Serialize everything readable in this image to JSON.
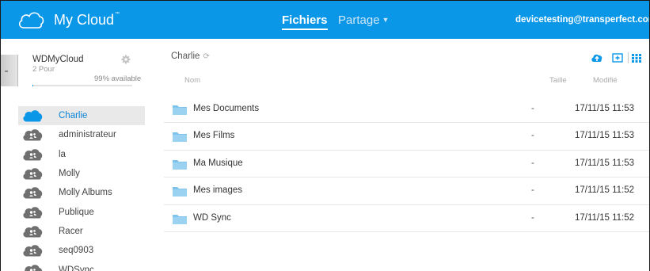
{
  "header": {
    "app_title": "My Cloud",
    "trademark": "™",
    "tabs": [
      {
        "label": "Fichiers",
        "active": true
      },
      {
        "label": "Partage",
        "active": false
      }
    ],
    "user_email": "devicetesting@transperfect.com",
    "brand_color": "#0a97e8"
  },
  "device": {
    "name": "WDMyCloud",
    "subtitle": "2 Pour",
    "storage_available": "99% available",
    "storage_used_percent": 1
  },
  "sidebar": {
    "shares": [
      {
        "label": "Charlie",
        "active": true,
        "icon": "cloud-icon"
      },
      {
        "label": "administrateur",
        "active": false,
        "icon": "shared-cloud-icon"
      },
      {
        "label": "la",
        "active": false,
        "icon": "shared-cloud-icon"
      },
      {
        "label": "Molly",
        "active": false,
        "icon": "shared-cloud-icon"
      },
      {
        "label": "Molly Albums",
        "active": false,
        "icon": "shared-cloud-icon"
      },
      {
        "label": "Publique",
        "active": false,
        "icon": "shared-cloud-icon"
      },
      {
        "label": "Racer",
        "active": false,
        "icon": "shared-cloud-icon"
      },
      {
        "label": "seq0903",
        "active": false,
        "icon": "shared-cloud-icon"
      },
      {
        "label": "WDSync",
        "active": false,
        "icon": "shared-cloud-icon"
      }
    ]
  },
  "main": {
    "breadcrumb": "Charlie",
    "columns": {
      "name": "Nom",
      "size": "Taille",
      "modified": "Modifié"
    },
    "toolbar": [
      "upload-icon",
      "new-folder-icon",
      "grid-view-icon"
    ],
    "folders": [
      {
        "name": "Mes Documents",
        "size": "-",
        "modified": "17/11/15 11:53"
      },
      {
        "name": "Mes Films",
        "size": "-",
        "modified": "17/11/15 11:53"
      },
      {
        "name": "Ma Musique",
        "size": "-",
        "modified": "17/11/15 11:53"
      },
      {
        "name": "Mes images",
        "size": "-",
        "modified": "17/11/15 11:52"
      },
      {
        "name": "WD Sync",
        "size": "-",
        "modified": "17/11/15 11:52"
      }
    ]
  }
}
